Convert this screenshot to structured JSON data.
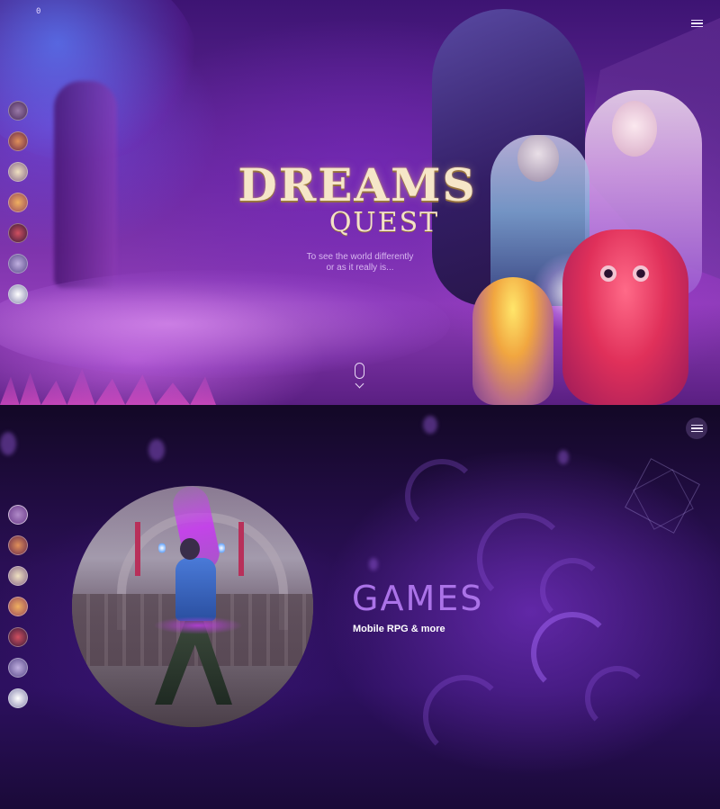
{
  "hero": {
    "logo_main": "DREAMS",
    "logo_sub": "QUEST",
    "tagline_line1": "To see the world differently",
    "tagline_line2": "or as it really is...",
    "vol_marker": "0"
  },
  "side_nav": {
    "items": [
      {
        "name": "nav-item-1",
        "color": "#6a4a7a"
      },
      {
        "name": "nav-item-2",
        "color": "#c06a4a"
      },
      {
        "name": "nav-item-3",
        "color": "#c9b08a"
      },
      {
        "name": "nav-item-4",
        "color": "#d09050"
      },
      {
        "name": "nav-item-5",
        "color": "#9a3a4a"
      },
      {
        "name": "nav-item-6",
        "color": "#8a7ab0"
      },
      {
        "name": "nav-item-7",
        "color": "#dcd8ee"
      }
    ]
  },
  "games": {
    "title": "GAMES",
    "subtitle": "Mobile RPG & more"
  },
  "colors": {
    "accent": "#ab73e8",
    "background_top": "#3d1473",
    "background_bottom": "#16092e"
  }
}
